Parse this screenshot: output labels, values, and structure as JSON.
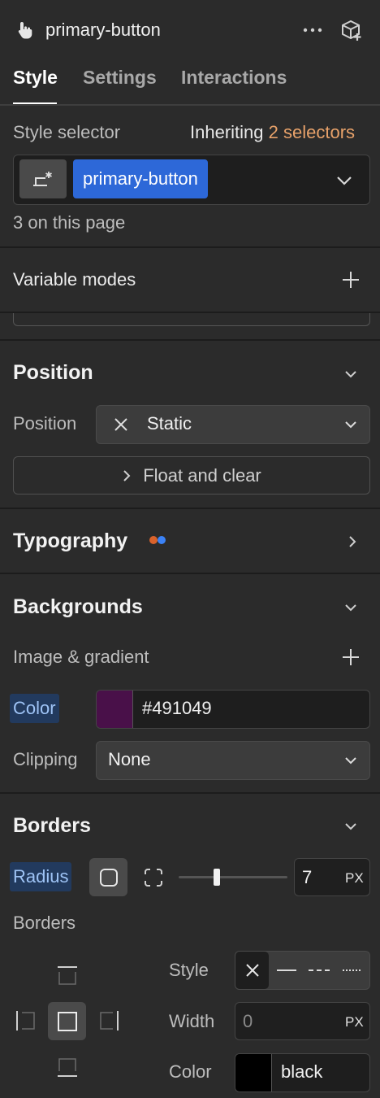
{
  "header": {
    "element_name": "primary-button",
    "icons": [
      "hand-pointer-icon",
      "more-icon",
      "component-add-icon"
    ]
  },
  "tabs": [
    {
      "label": "Style",
      "active": true
    },
    {
      "label": "Settings",
      "active": false
    },
    {
      "label": "Interactions",
      "active": false
    }
  ],
  "selector": {
    "label": "Style selector",
    "inheriting_prefix": "Inheriting",
    "inheriting_count": "2 selectors",
    "chip": "primary-button",
    "usage": "3 on this page"
  },
  "variable_modes": {
    "label": "Variable modes"
  },
  "position": {
    "title": "Position",
    "row_label": "Position",
    "value": "Static",
    "float_button": "Float and clear"
  },
  "typography": {
    "title": "Typography"
  },
  "backgrounds": {
    "title": "Backgrounds",
    "image_gradient_label": "Image & gradient",
    "color_label": "Color",
    "color_value": "#491049",
    "color_swatch": "#491049",
    "clipping_label": "Clipping",
    "clipping_value": "None"
  },
  "borders": {
    "title": "Borders",
    "radius_label": "Radius",
    "radius_value": "7",
    "radius_unit": "PX",
    "radius_slider_fraction": 0.35,
    "borders_label": "Borders",
    "style_label": "Style",
    "width_label": "Width",
    "width_value": "0",
    "width_unit": "PX",
    "color_label": "Color",
    "color_value": "black",
    "color_swatch": "#000000"
  },
  "colors": {
    "accent": "#2d68d8",
    "orange": "#e8a26a",
    "dot_orange": "#d9622b",
    "dot_blue": "#3b82f6"
  }
}
